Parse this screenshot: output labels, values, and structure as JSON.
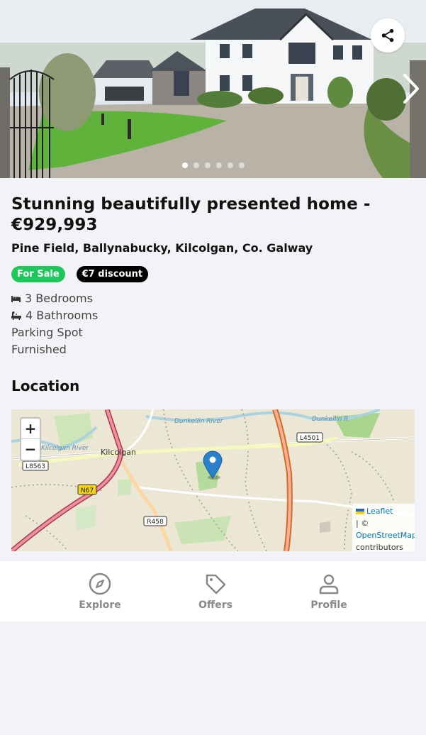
{
  "listing": {
    "title": "Stunning beautifully presented home - €929,993",
    "address": "Pine Field, Ballynabucky, Kilcolgan, Co. Galway",
    "badges": {
      "status": "For Sale",
      "discount": "€7 discount"
    },
    "features": {
      "bedrooms": "3 Bedrooms",
      "bathrooms": "4 Bathrooms",
      "parking": "Parking Spot",
      "furnished": "Furnished"
    }
  },
  "gallery": {
    "image_count": 6,
    "active_index": 0
  },
  "location": {
    "heading": "Location",
    "map": {
      "zoom_in": "+",
      "zoom_out": "−",
      "labels": {
        "town": "Kilcolgan",
        "river_west": "Kilcolgan River",
        "river_north": "Dunkellin River",
        "river_ne": "Dunkellin R",
        "road_l8563": "L8563",
        "road_n67": "N67",
        "road_r458": "R458",
        "road_l4501": "L4501"
      },
      "attribution": {
        "leaflet": "Leaflet",
        "sep": " | © ",
        "osm": "OpenStreetMap",
        "contributors": "contributors"
      }
    }
  },
  "tabbar": {
    "explore": "Explore",
    "offers": "Offers",
    "profile": "Profile"
  },
  "colors": {
    "sale": "#1ec65b",
    "discount": "#000000",
    "tab_inactive": "#888888",
    "marker": "#2a81cb"
  }
}
